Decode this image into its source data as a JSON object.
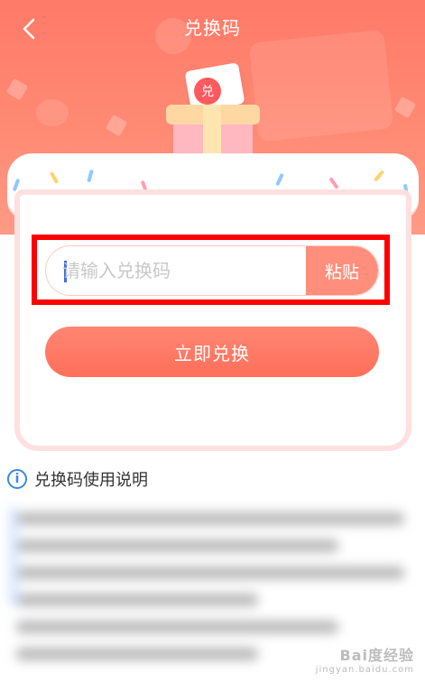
{
  "header": {
    "title": "兑换码",
    "back_icon": "chevron-left-icon"
  },
  "gift_badge": "兑",
  "form": {
    "code_placeholder": "请输入兑换码",
    "code_value": "",
    "paste_label": "粘贴",
    "submit_label": "立即兑换"
  },
  "instructions": {
    "icon": "info-icon",
    "info_glyph": "i",
    "title": "兑换码使用说明"
  },
  "watermark": {
    "main": "Bai度经验",
    "sub": "jingyan.baidu.com"
  },
  "colors": {
    "header": "#ff7a68",
    "button": "#ff7a66",
    "highlight": "#ff0000",
    "cursor": "#3a6fe0",
    "info": "#3b87e8"
  }
}
